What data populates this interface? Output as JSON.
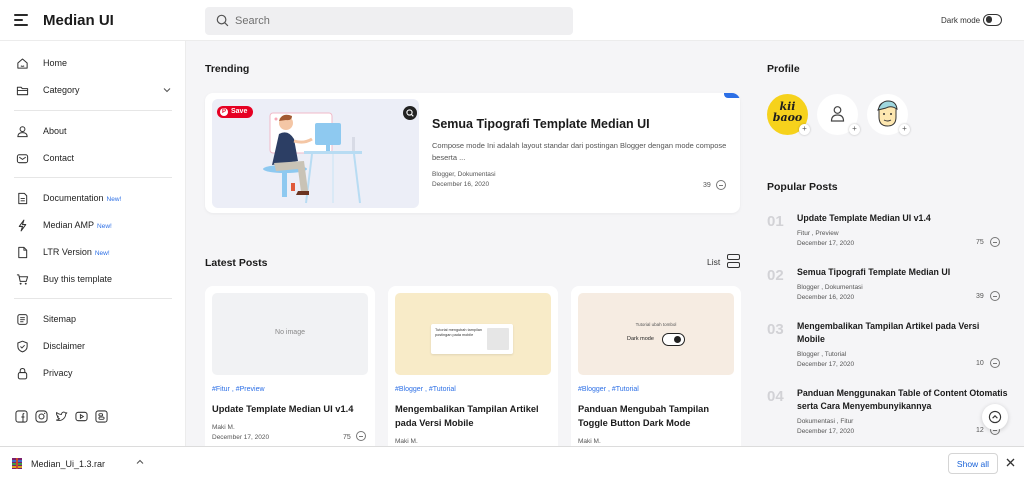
{
  "header": {
    "brand": "Median UI",
    "search_placeholder": "Search",
    "dark_mode_label": "Dark mode"
  },
  "sidebar": {
    "items": [
      {
        "label": "Home",
        "icon": "home-icon"
      },
      {
        "label": "Category",
        "icon": "folder-icon"
      },
      {
        "label": "About",
        "icon": "user-icon"
      },
      {
        "label": "Contact",
        "icon": "mail-icon"
      },
      {
        "label": "Documentation",
        "badge": "New!",
        "icon": "document-icon"
      },
      {
        "label": "Median AMP",
        "badge": "New!",
        "icon": "bolt-icon"
      },
      {
        "label": "LTR Version",
        "badge": "New!",
        "icon": "file-icon"
      },
      {
        "label": "Buy this template",
        "icon": "cart-icon"
      },
      {
        "label": "Sitemap",
        "icon": "sitemap-icon"
      },
      {
        "label": "Disclaimer",
        "icon": "shield-icon"
      },
      {
        "label": "Privacy",
        "icon": "lock-icon"
      }
    ],
    "socials": [
      "facebook-icon",
      "instagram-icon",
      "twitter-icon",
      "youtube-icon",
      "blogger-icon"
    ]
  },
  "trending": {
    "section_title": "Trending",
    "save_label": "Save",
    "title": "Semua Tipografi Template Median UI",
    "description": "Compose mode Ini adalah layout standar dari postingan Blogger dengan mode compose beserta ...",
    "tags": "Blogger, Dokumentasi",
    "date": "December 16, 2020",
    "comments": "39"
  },
  "latest": {
    "section_title": "Latest Posts",
    "view_label": "List",
    "posts": [
      {
        "no_image": "No image",
        "tags": "#Fitur , #Preview",
        "title": "Update Template Median UI v1.4",
        "author": "Maki M.",
        "date": "December 17, 2020",
        "comments": "75"
      },
      {
        "thumb_text": "Tutorial mengubah tampilan postingan pada mobile",
        "tags": "#Blogger , #Tutorial",
        "title": "Mengembalikan Tampilan Artikel pada Versi Mobile",
        "author": "Maki M."
      },
      {
        "thumb_caption": "Tutorial ubah tombol",
        "thumb_toggle_label": "Dark mode",
        "tags": "#Blogger , #Tutorial",
        "title": "Panduan Mengubah Tampilan Toggle Button Dark Mode",
        "author": "Maki M."
      }
    ]
  },
  "profile": {
    "section_title": "Profile",
    "avatar1_text_top": "kii",
    "avatar1_text_bottom": "baoo",
    "plus": "+"
  },
  "popular": {
    "section_title": "Popular Posts",
    "posts": [
      {
        "num": "01",
        "title": "Update Template Median UI v1.4",
        "tags": "Fitur , Preview",
        "date": "December 17, 2020",
        "comments": "75"
      },
      {
        "num": "02",
        "title": "Semua Tipografi Template Median UI",
        "tags": "Blogger , Dokumentasi",
        "date": "December 16, 2020",
        "comments": "39"
      },
      {
        "num": "03",
        "title": "Mengembalikan Tampilan Artikel pada Versi Mobile",
        "tags": "Blogger , Tutorial",
        "date": "December 17, 2020",
        "comments": "10"
      },
      {
        "num": "04",
        "title": "Panduan Menggunakan Table of Content Otomatis serta Cara Menyembunyikannya",
        "tags": "Dokumentasi , Fitur",
        "date": "December 17, 2020",
        "comments": "12"
      }
    ]
  },
  "download_bar": {
    "file_name": "Median_Ui_1.3.rar",
    "show_all_label": "Show all"
  },
  "colors": {
    "accent": "#2c6fe6",
    "pinterest": "#e60023",
    "avatar_yellow": "#f6d21c"
  }
}
